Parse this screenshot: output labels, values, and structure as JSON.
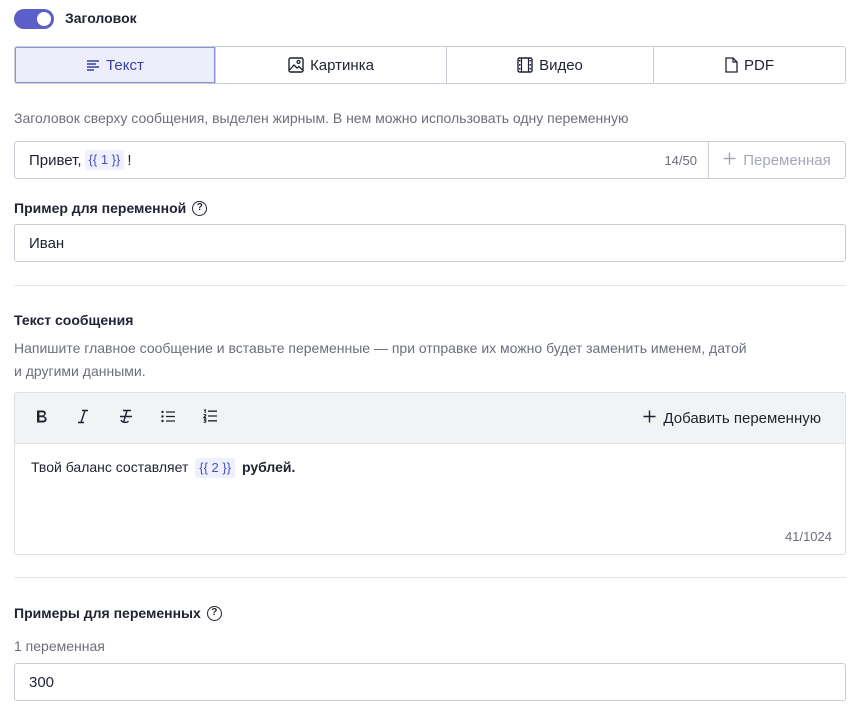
{
  "header_toggle": {
    "label": "Заголовок",
    "enabled": true
  },
  "tabs": [
    {
      "label": "Текст",
      "icon": "text-lines-icon",
      "active": true
    },
    {
      "label": "Картинка",
      "icon": "image-icon",
      "active": false
    },
    {
      "label": "Видео",
      "icon": "film-icon",
      "active": false
    },
    {
      "label": "PDF",
      "icon": "file-icon",
      "active": false
    }
  ],
  "header_field": {
    "hint": "Заголовок сверху сообщения, выделен жирным. В нем можно использовать одну переменную",
    "text_before": "Привет,",
    "variable": "{{ 1 }}",
    "text_after": "!",
    "counter": "14/50",
    "add_variable_label": "Переменная"
  },
  "example_variable": {
    "label": "Пример для переменной",
    "value": "Иван"
  },
  "message": {
    "title": "Текст сообщения",
    "hint_line1": "Напишите главное сообщение и вставьте переменные — при отправке их можно будет заменить именем, датой",
    "hint_line2": "и другими данными.",
    "add_variable_label": "Добавить переменную",
    "body_before": "Твой баланс составляет",
    "variable": "{{ 2 }}",
    "body_bold": "рублей.",
    "counter": "41/1024"
  },
  "variable_examples": {
    "title": "Примеры для переменных",
    "sublabel": "1 переменная",
    "value": "300"
  },
  "colors": {
    "accent": "#5b5fc7",
    "active_tab_bg": "#eceefb",
    "chip_bg": "#eef0fb"
  }
}
